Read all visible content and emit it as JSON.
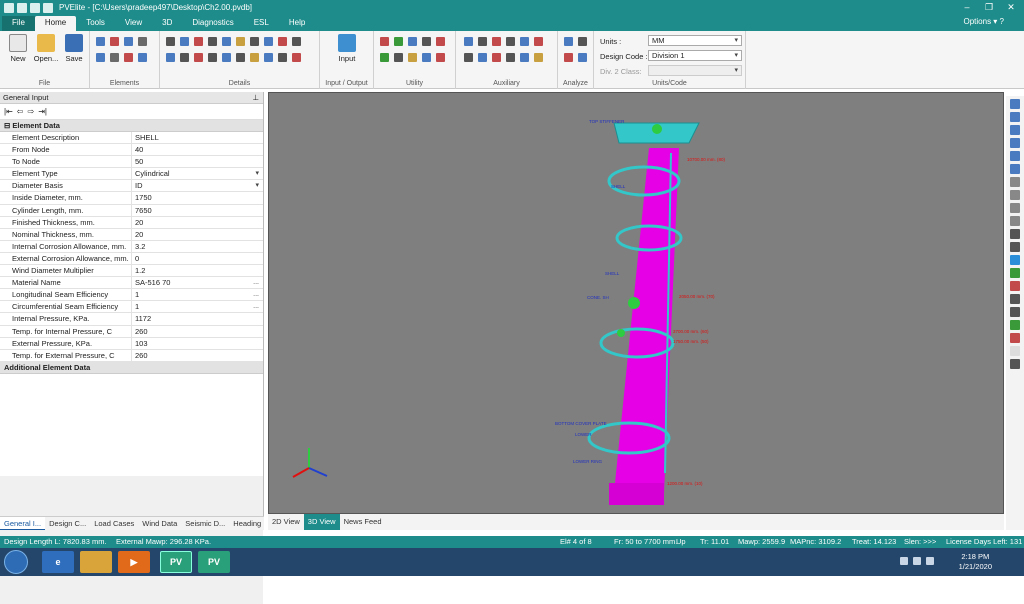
{
  "window": {
    "title": "PVElite - [C:\\Users\\pradeep497\\Desktop\\Ch2.00.pvdb]",
    "controls": [
      "–",
      "❐",
      "✕"
    ]
  },
  "ribbon_tabs": [
    {
      "label": "File"
    },
    {
      "label": "Home"
    },
    {
      "label": "Tools"
    },
    {
      "label": "View"
    },
    {
      "label": "3D"
    },
    {
      "label": "Diagnostics"
    },
    {
      "label": "ESL"
    },
    {
      "label": "Help"
    }
  ],
  "options_label": "Options",
  "ribbon": {
    "file_group": {
      "new": "New",
      "open": "Open...",
      "save": "Save",
      "label": "File"
    },
    "elements_label": "Elements",
    "details_label": "Details",
    "input_label": "Input",
    "input_output_label": "Input / Output",
    "utility_label": "Utility",
    "auxiliary_label": "Auxiliary",
    "analyze_label": "Analyze",
    "units_code_label": "Units/Code",
    "units": {
      "label": "Units :",
      "value": "MM"
    },
    "design_code": {
      "label": "Design Code :",
      "value": "Division 1"
    },
    "div2_class": {
      "label": "Div. 2 Class:",
      "value": ""
    }
  },
  "panel": {
    "title": "General Input",
    "section1": "Element Data",
    "section2": "Additional Element Data",
    "rows": [
      {
        "key": "Element Description",
        "value": "SHELL"
      },
      {
        "key": "From Node",
        "value": "40"
      },
      {
        "key": "To Node",
        "value": "50"
      },
      {
        "key": "Element Type",
        "value": "Cylindrical",
        "ind": "▾"
      },
      {
        "key": "Diameter Basis",
        "value": "ID",
        "ind": "▾"
      },
      {
        "key": "Inside Diameter, mm.",
        "value": "1750"
      },
      {
        "key": "Cylinder Length, mm.",
        "value": "7650"
      },
      {
        "key": "Finished Thickness, mm.",
        "value": "20"
      },
      {
        "key": "Nominal Thickness, mm.",
        "value": "20"
      },
      {
        "key": "Internal Corrosion Allowance, mm.",
        "value": "3.2"
      },
      {
        "key": "External Corrosion Allowance, mm.",
        "value": "0"
      },
      {
        "key": "Wind Diameter Multiplier",
        "value": "1.2"
      },
      {
        "key": "Material Name",
        "value": "SA-516 70",
        "ind": "..."
      },
      {
        "key": "Longitudinal Seam Efficiency",
        "value": "1",
        "ind": "..."
      },
      {
        "key": "Circumferential Seam Efficiency",
        "value": "1",
        "ind": "..."
      },
      {
        "key": "Internal Pressure, KPa.",
        "value": "1172"
      },
      {
        "key": "Temp. for Internal Pressure, C",
        "value": "260"
      },
      {
        "key": "External Pressure, KPa.",
        "value": "103"
      },
      {
        "key": "Temp. for External Pressure, C",
        "value": "260"
      }
    ]
  },
  "bottom_tabs": [
    "General I...",
    "Design C...",
    "Load Cases",
    "Wind Data",
    "Seismic D...",
    "Heading"
  ],
  "view_tabs": [
    "2D View",
    "3D View",
    "News Feed"
  ],
  "model_labels": {
    "top_stiffener": "TOP STIFFENER",
    "top_dim": "10700.00 mm. (80)",
    "shell": "SHELL",
    "shell2": "SHELL",
    "cone": "CONE. SH",
    "mid_dim": "2050.00 mm. (70)",
    "dim3": "3700.00 mm. (60)",
    "dim4": "1750.00 mm. (50)",
    "bottom_cover": "BOTTOM COVER PLATE",
    "lower": "LOWER",
    "lower_ring": "LOWER RING",
    "bottom_dim": "1200.00 mm. (10)"
  },
  "status": {
    "design_length": "Design Length L: 7820.83 mm.",
    "ext_mawp": "External Mawp: 296.28 KPa.",
    "el": "El# 4 of 8",
    "fr": "Fr: 50 to 7700 mm.",
    "up": "Up",
    "tr": "Tr: 11.01",
    "mawp": "Mawp: 2559.9",
    "mapnc": "MAPnc: 3109.2",
    "treat": "Treat: 14.123",
    "slen": "Slen: >>>",
    "license": "License Days Left: 131"
  },
  "taskbar": {
    "time": "2:18 PM",
    "date": "1/21/2020",
    "pv1": "PV",
    "pv2": "PV"
  },
  "colors": {
    "teal": "#1e8c8a",
    "vessel": "#e600e6",
    "platform": "#33c7c9",
    "viewport": "#7f7f7f"
  }
}
